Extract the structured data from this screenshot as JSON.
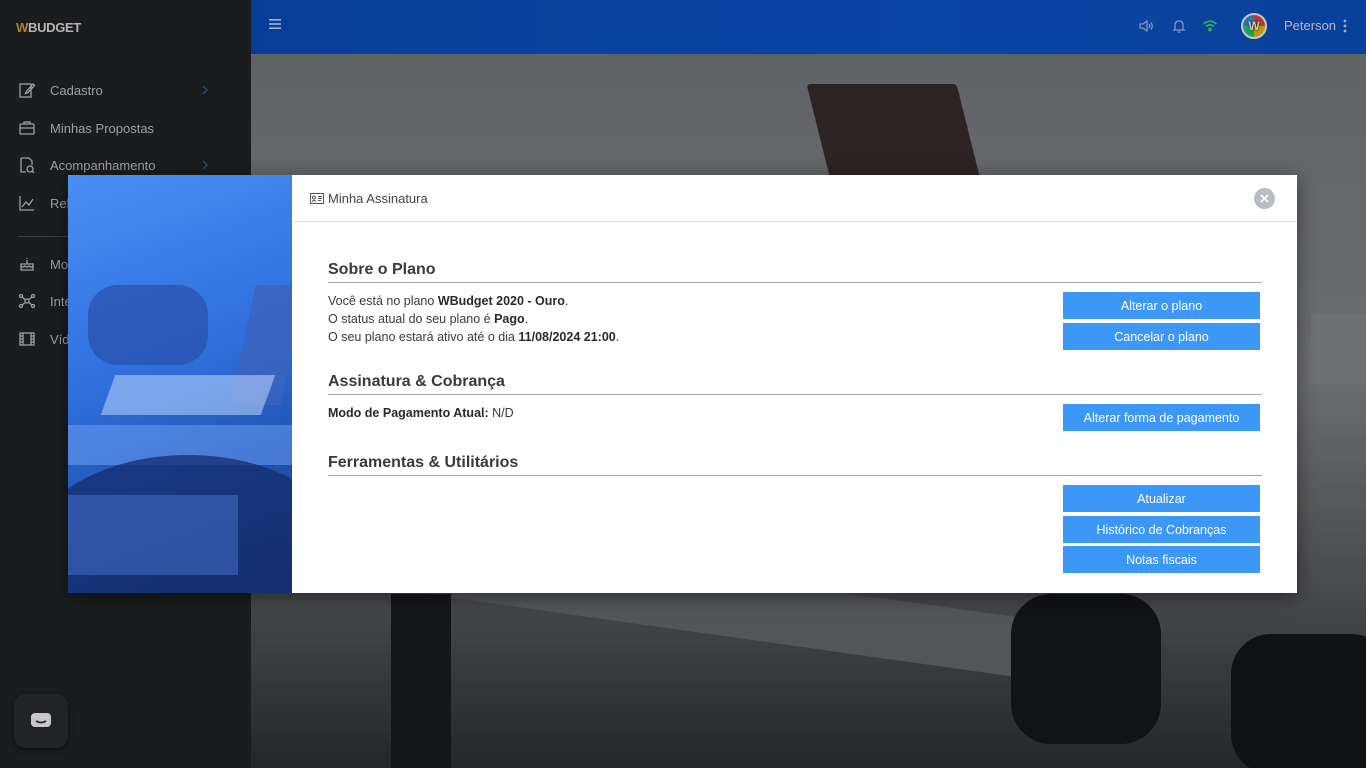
{
  "app": {
    "logo_w": "W",
    "logo_rest": "BUDGET"
  },
  "sidebar": {
    "items": [
      {
        "label": "Cadastro",
        "icon": "edit-icon",
        "has_chevron": true
      },
      {
        "label": "Minhas Propostas",
        "icon": "briefcase-icon",
        "has_chevron": false
      },
      {
        "label": "Acompanhamento",
        "icon": "document-search-icon",
        "has_chevron": true
      },
      {
        "label": "Rel",
        "icon": "chart-icon",
        "has_chevron": false
      },
      {
        "label": "Mo",
        "icon": "cake-icon",
        "has_chevron": false
      },
      {
        "label": "Inte",
        "icon": "network-icon",
        "has_chevron": false
      },
      {
        "label": "Víd",
        "icon": "film-icon",
        "has_chevron": false
      }
    ]
  },
  "header": {
    "username": "Peterson",
    "avatar_letter": "W"
  },
  "modal": {
    "title": "Minha Assinatura",
    "sections": {
      "plan": {
        "heading": "Sobre o Plano",
        "line1_prefix": "Você está no plano ",
        "plan_name": "WBudget 2020 - Ouro",
        "line1_suffix": ".",
        "line2_prefix": "O status atual do seu plano é ",
        "status": "Pago",
        "line2_suffix": ".",
        "line3_prefix": "O seu plano estará ativo até o dia ",
        "active_until": "11/08/2024 21:00",
        "line3_suffix": ".",
        "buttons": {
          "change": "Alterar o plano",
          "cancel": "Cancelar o plano"
        }
      },
      "billing": {
        "heading": "Assinatura & Cobrança",
        "payment_label": "Modo de Pagamento Atual:",
        "payment_value": " N/D",
        "buttons": {
          "change_payment": "Alterar forma de pagamento"
        }
      },
      "tools": {
        "heading": "Ferramentas & Utilitários",
        "buttons": {
          "update": "Atualizar",
          "history": "Histórico de Cobranças",
          "invoices": "Notas fiscais"
        }
      }
    }
  },
  "colors": {
    "topbar": "#0d5ad4",
    "sidebar": "#232427",
    "button": "#3d97f7"
  }
}
